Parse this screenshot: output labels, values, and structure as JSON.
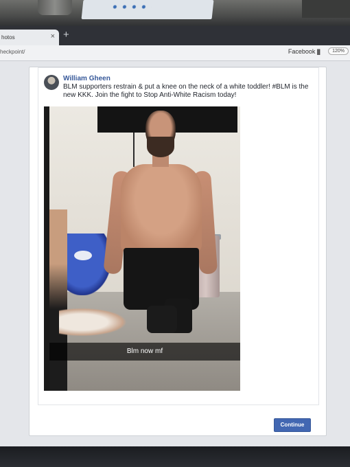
{
  "browser": {
    "tab_title": "hotos",
    "tab_close": "×",
    "new_tab": "+",
    "url": "heckpoint/",
    "site_label": "Facebook",
    "site_icon": "bars-icon",
    "zoom": "120%"
  },
  "post": {
    "author": "William Gheen",
    "text": "BLM supporters restrain & put a knee on the neck of a white toddler! #BLM is the new KKK. Join the fight to Stop Anti-White Racism today!",
    "photo_caption": "Blm now mf"
  },
  "actions": {
    "continue_label": "Continue"
  },
  "colors": {
    "link": "#365899",
    "button": "#4267b2",
    "page_bg": "#e4e6ea"
  }
}
